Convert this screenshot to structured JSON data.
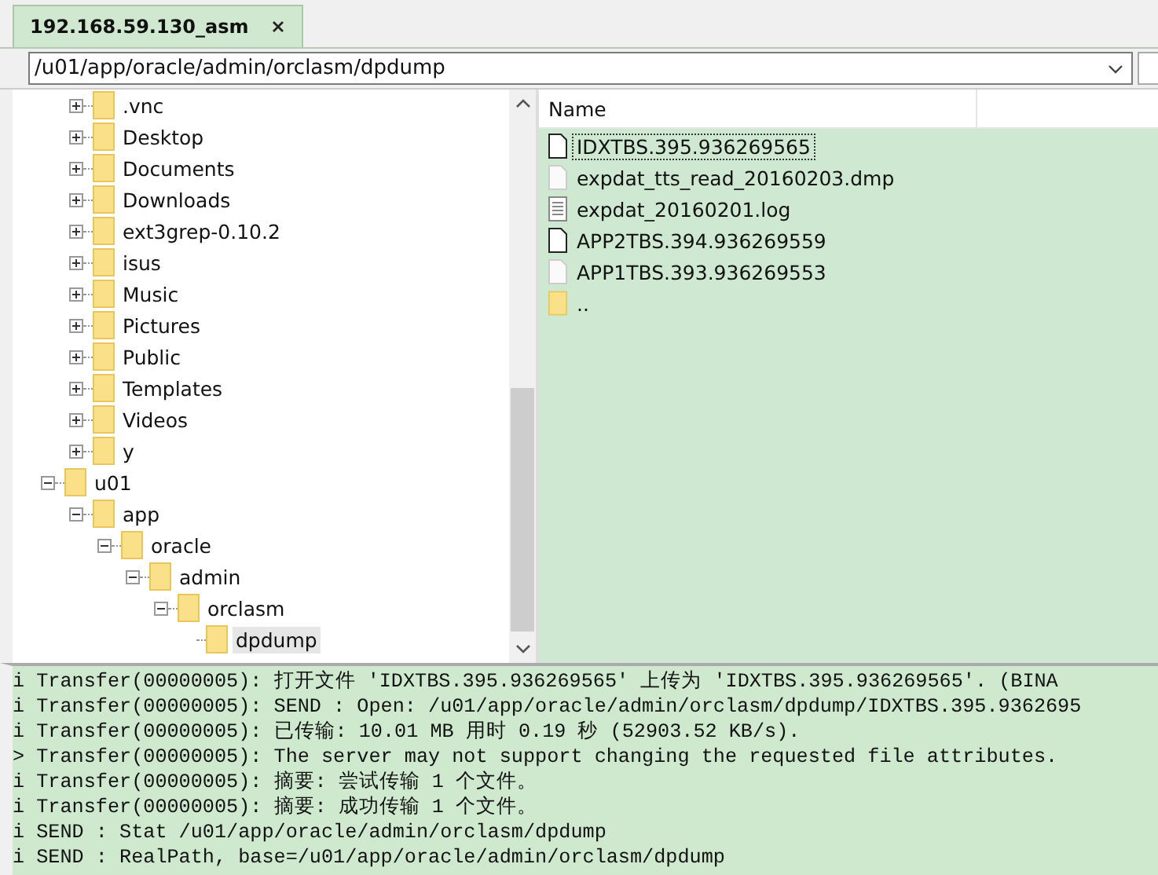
{
  "tabs": [
    {
      "label": "192.168.59.130_asm",
      "selected": true,
      "closable": true
    }
  ],
  "path_field": {
    "value": "/u01/app/oracle/admin/orclasm/dpdump"
  },
  "tree": {
    "scrolled_items": [
      {
        "label": ".vnc",
        "expanded": false,
        "selected": false
      },
      {
        "label": "Desktop",
        "expanded": false,
        "selected": false
      },
      {
        "label": "Documents",
        "expanded": false,
        "selected": false
      },
      {
        "label": "Downloads",
        "expanded": false,
        "selected": false
      },
      {
        "label": "ext3grep-0.10.2",
        "expanded": false,
        "selected": false
      },
      {
        "label": "isus",
        "expanded": false,
        "selected": false
      },
      {
        "label": "Music",
        "expanded": false,
        "selected": false
      },
      {
        "label": "Pictures",
        "expanded": false,
        "selected": false
      },
      {
        "label": "Public",
        "expanded": false,
        "selected": false
      },
      {
        "label": "Templates",
        "expanded": false,
        "selected": false
      },
      {
        "label": "Videos",
        "expanded": false,
        "selected": false
      },
      {
        "label": "y",
        "expanded": false,
        "selected": false
      }
    ],
    "items": [
      {
        "label": "u01",
        "expanded": true,
        "selected": false,
        "children": [
          {
            "label": "app",
            "expanded": true,
            "selected": false,
            "children": [
              {
                "label": "oracle",
                "expanded": true,
                "selected": false,
                "children": [
                  {
                    "label": "admin",
                    "expanded": true,
                    "selected": false,
                    "children": [
                      {
                        "label": "orclasm",
                        "expanded": true,
                        "selected": false,
                        "children": [
                          {
                            "label": "dpdump",
                            "selected": true
                          }
                        ]
                      }
                    ]
                  }
                ]
              }
            ]
          }
        ]
      }
    ]
  },
  "file_list": {
    "columns": [
      "Name"
    ],
    "files": [
      {
        "name": "IDXTBS.395.936269565",
        "kind": "file",
        "focused": true
      },
      {
        "name": "expdat_tts_read_20160203.dmp",
        "kind": "data",
        "focused": false
      },
      {
        "name": "expdat_20160201.log",
        "kind": "text",
        "focused": false
      },
      {
        "name": "APP2TBS.394.936269559",
        "kind": "file",
        "focused": false
      },
      {
        "name": "APP1TBS.393.936269553",
        "kind": "data",
        "focused": false
      },
      {
        "name": "..",
        "kind": "folder",
        "focused": false
      }
    ]
  },
  "log": [
    "i Transfer(00000005): 打开文件 'IDXTBS.395.936269565' 上传为 'IDXTBS.395.936269565'. (BINA",
    "i Transfer(00000005): SEND : Open: /u01/app/oracle/admin/orclasm/dpdump/IDXTBS.395.9362695",
    "i Transfer(00000005): 已传输: 10.01 MB 用时 0.19 秒 (52903.52 KB/s).",
    "> Transfer(00000005): The server may not support changing the requested file attributes.",
    "i Transfer(00000005): 摘要: 尝试传输 1 个文件。",
    "i Transfer(00000005): 摘要: 成功传输 1 个文件。",
    "i SEND : Stat /u01/app/oracle/admin/orclasm/dpdump",
    "i SEND : RealPath, base=/u01/app/oracle/admin/orclasm/dpdump"
  ]
}
